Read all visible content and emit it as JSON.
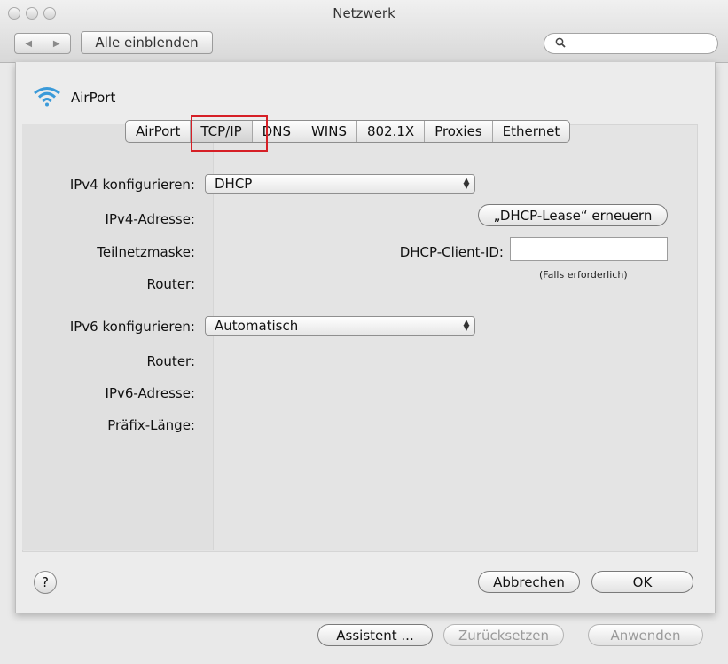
{
  "window": {
    "title": "Netzwerk"
  },
  "toolbar": {
    "back_icon": "◀",
    "forward_icon": "▶",
    "show_all_label": "Alle einblenden",
    "search_placeholder": ""
  },
  "service": {
    "name": "AirPort"
  },
  "tabs": [
    {
      "label": "AirPort",
      "active": false
    },
    {
      "label": "TCP/IP",
      "active": true
    },
    {
      "label": "DNS",
      "active": false
    },
    {
      "label": "WINS",
      "active": false
    },
    {
      "label": "802.1X",
      "active": false
    },
    {
      "label": "Proxies",
      "active": false
    },
    {
      "label": "Ethernet",
      "active": false
    }
  ],
  "ipv4": {
    "configure_label": "IPv4 konfigurieren:",
    "configure_value": "DHCP",
    "address_label": "IPv4-Adresse:",
    "subnet_label": "Teilnetzmaske:",
    "router_label": "Router:",
    "renew_button": "„DHCP-Lease“ erneuern",
    "client_id_label": "DHCP-Client-ID:",
    "client_id_value": "",
    "client_id_hint": "(Falls erforderlich)"
  },
  "ipv6": {
    "configure_label": "IPv6 konfigurieren:",
    "configure_value": "Automatisch",
    "router_label": "Router:",
    "address_label": "IPv6-Adresse:",
    "prefix_label": "Präfix-Länge:"
  },
  "sheet_buttons": {
    "help": "?",
    "cancel": "Abbrechen",
    "ok": "OK"
  },
  "footer_buttons": {
    "assistant": "Assistent ...",
    "revert": "Zurücksetzen",
    "apply": "Anwenden"
  },
  "colors": {
    "highlight_box": "#d61f26",
    "wifi_icon": "#3a9ad9"
  }
}
